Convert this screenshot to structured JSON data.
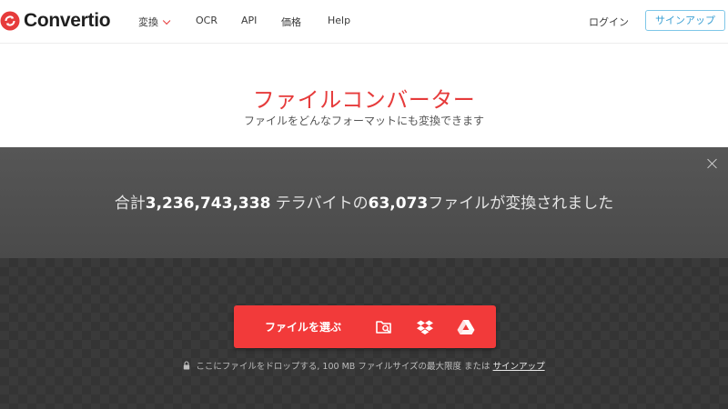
{
  "header": {
    "logo_text": "Convertio",
    "nav": [
      "変換",
      "OCR",
      "API",
      "価格",
      "Help"
    ],
    "login": "ログイン",
    "signup": "サインアップ"
  },
  "hero": {
    "title": "ファイルコンバーター",
    "subtitle": "ファイルをどんなフォーマットにも変換できます"
  },
  "stats": {
    "prefix": "合計",
    "terabytes": "3,236,743,338",
    "middle": " テラバイトの",
    "files": "63,073",
    "suffix": "ファイルが変換されました"
  },
  "upload": {
    "choose_label": "ファイルを選ぶ",
    "note_text": "ここにファイルをドロップする, 100 MB ファイルサイズの最大限度 または ",
    "note_link": "サインアップ",
    "icons": [
      "folder-search-icon",
      "dropbox-icon",
      "google-drive-icon"
    ]
  },
  "colors": {
    "accent": "#f23a3a",
    "signup_border": "#7fc7e8",
    "dark_band": "#505050"
  }
}
